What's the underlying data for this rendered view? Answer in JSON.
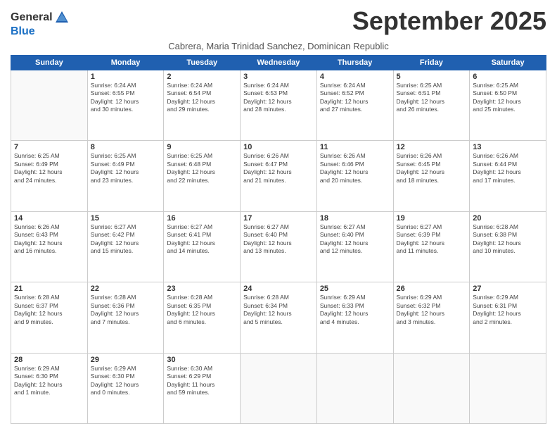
{
  "header": {
    "logo_general": "General",
    "logo_blue": "Blue",
    "month": "September 2025",
    "location": "Cabrera, Maria Trinidad Sanchez, Dominican Republic"
  },
  "days_of_week": [
    "Sunday",
    "Monday",
    "Tuesday",
    "Wednesday",
    "Thursday",
    "Friday",
    "Saturday"
  ],
  "weeks": [
    [
      {
        "day": "",
        "info": ""
      },
      {
        "day": "1",
        "info": "Sunrise: 6:24 AM\nSunset: 6:55 PM\nDaylight: 12 hours\nand 30 minutes."
      },
      {
        "day": "2",
        "info": "Sunrise: 6:24 AM\nSunset: 6:54 PM\nDaylight: 12 hours\nand 29 minutes."
      },
      {
        "day": "3",
        "info": "Sunrise: 6:24 AM\nSunset: 6:53 PM\nDaylight: 12 hours\nand 28 minutes."
      },
      {
        "day": "4",
        "info": "Sunrise: 6:24 AM\nSunset: 6:52 PM\nDaylight: 12 hours\nand 27 minutes."
      },
      {
        "day": "5",
        "info": "Sunrise: 6:25 AM\nSunset: 6:51 PM\nDaylight: 12 hours\nand 26 minutes."
      },
      {
        "day": "6",
        "info": "Sunrise: 6:25 AM\nSunset: 6:50 PM\nDaylight: 12 hours\nand 25 minutes."
      }
    ],
    [
      {
        "day": "7",
        "info": "Sunrise: 6:25 AM\nSunset: 6:49 PM\nDaylight: 12 hours\nand 24 minutes."
      },
      {
        "day": "8",
        "info": "Sunrise: 6:25 AM\nSunset: 6:49 PM\nDaylight: 12 hours\nand 23 minutes."
      },
      {
        "day": "9",
        "info": "Sunrise: 6:25 AM\nSunset: 6:48 PM\nDaylight: 12 hours\nand 22 minutes."
      },
      {
        "day": "10",
        "info": "Sunrise: 6:26 AM\nSunset: 6:47 PM\nDaylight: 12 hours\nand 21 minutes."
      },
      {
        "day": "11",
        "info": "Sunrise: 6:26 AM\nSunset: 6:46 PM\nDaylight: 12 hours\nand 20 minutes."
      },
      {
        "day": "12",
        "info": "Sunrise: 6:26 AM\nSunset: 6:45 PM\nDaylight: 12 hours\nand 18 minutes."
      },
      {
        "day": "13",
        "info": "Sunrise: 6:26 AM\nSunset: 6:44 PM\nDaylight: 12 hours\nand 17 minutes."
      }
    ],
    [
      {
        "day": "14",
        "info": "Sunrise: 6:26 AM\nSunset: 6:43 PM\nDaylight: 12 hours\nand 16 minutes."
      },
      {
        "day": "15",
        "info": "Sunrise: 6:27 AM\nSunset: 6:42 PM\nDaylight: 12 hours\nand 15 minutes."
      },
      {
        "day": "16",
        "info": "Sunrise: 6:27 AM\nSunset: 6:41 PM\nDaylight: 12 hours\nand 14 minutes."
      },
      {
        "day": "17",
        "info": "Sunrise: 6:27 AM\nSunset: 6:40 PM\nDaylight: 12 hours\nand 13 minutes."
      },
      {
        "day": "18",
        "info": "Sunrise: 6:27 AM\nSunset: 6:40 PM\nDaylight: 12 hours\nand 12 minutes."
      },
      {
        "day": "19",
        "info": "Sunrise: 6:27 AM\nSunset: 6:39 PM\nDaylight: 12 hours\nand 11 minutes."
      },
      {
        "day": "20",
        "info": "Sunrise: 6:28 AM\nSunset: 6:38 PM\nDaylight: 12 hours\nand 10 minutes."
      }
    ],
    [
      {
        "day": "21",
        "info": "Sunrise: 6:28 AM\nSunset: 6:37 PM\nDaylight: 12 hours\nand 9 minutes."
      },
      {
        "day": "22",
        "info": "Sunrise: 6:28 AM\nSunset: 6:36 PM\nDaylight: 12 hours\nand 7 minutes."
      },
      {
        "day": "23",
        "info": "Sunrise: 6:28 AM\nSunset: 6:35 PM\nDaylight: 12 hours\nand 6 minutes."
      },
      {
        "day": "24",
        "info": "Sunrise: 6:28 AM\nSunset: 6:34 PM\nDaylight: 12 hours\nand 5 minutes."
      },
      {
        "day": "25",
        "info": "Sunrise: 6:29 AM\nSunset: 6:33 PM\nDaylight: 12 hours\nand 4 minutes."
      },
      {
        "day": "26",
        "info": "Sunrise: 6:29 AM\nSunset: 6:32 PM\nDaylight: 12 hours\nand 3 minutes."
      },
      {
        "day": "27",
        "info": "Sunrise: 6:29 AM\nSunset: 6:31 PM\nDaylight: 12 hours\nand 2 minutes."
      }
    ],
    [
      {
        "day": "28",
        "info": "Sunrise: 6:29 AM\nSunset: 6:30 PM\nDaylight: 12 hours\nand 1 minute."
      },
      {
        "day": "29",
        "info": "Sunrise: 6:29 AM\nSunset: 6:30 PM\nDaylight: 12 hours\nand 0 minutes."
      },
      {
        "day": "30",
        "info": "Sunrise: 6:30 AM\nSunset: 6:29 PM\nDaylight: 11 hours\nand 59 minutes."
      },
      {
        "day": "",
        "info": ""
      },
      {
        "day": "",
        "info": ""
      },
      {
        "day": "",
        "info": ""
      },
      {
        "day": "",
        "info": ""
      }
    ]
  ]
}
